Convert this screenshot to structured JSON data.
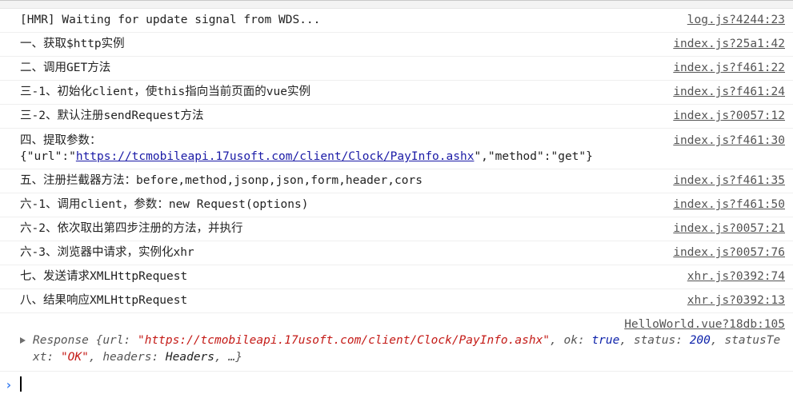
{
  "logs": [
    {
      "message": "[HMR] Waiting for update signal from WDS...",
      "source": "log.js?4244:23"
    },
    {
      "message": "一、获取$http实例",
      "source": "index.js?25a1:42"
    },
    {
      "message": "二、调用GET方法",
      "source": "index.js?f461:22"
    },
    {
      "message": "三-1、初始化client，使this指向当前页面的vue实例",
      "source": "index.js?f461:24"
    },
    {
      "message": "三-2、默认注册sendRequest方法",
      "source": "index.js?0057:12"
    },
    {
      "message": "四、提取参数：",
      "source": "index.js?f461:30",
      "json_prefix": "{\"url\":\"",
      "json_link": "https://tcmobileapi.17usoft.com/client/Clock/PayInfo.ashx",
      "json_suffix": "\",\"method\":\"get\"}"
    },
    {
      "message": "五、注册拦截器方法：before,method,jsonp,json,form,header,cors",
      "source": "index.js?f461:35"
    },
    {
      "message": "六-1、调用client，参数：new Request(options)",
      "source": "index.js?f461:50"
    },
    {
      "message": "六-2、依次取出第四步注册的方法，并执行",
      "source": "index.js?0057:21"
    },
    {
      "message": "六-3、浏览器中请求，实例化xhr",
      "source": "index.js?0057:76"
    },
    {
      "message": "七、发送请求XMLHttpRequest",
      "source": "xhr.js?0392:74"
    },
    {
      "message": "八、结果响应XMLHttpRequest",
      "source": "xhr.js?0392:13"
    }
  ],
  "response_log": {
    "source": "HelloWorld.vue?18db:105",
    "type_name": "Response",
    "open_brace": " {",
    "url_key": "url",
    "url_value": "\"https://tcmobileapi.17usoft.com/client/Clock/PayInfo.ashx\"",
    "ok_key": "ok",
    "ok_value": "true",
    "status_key": "status",
    "status_value": "200",
    "status_text_key": "statusText",
    "status_text_value": "\"OK\"",
    "headers_key": "headers",
    "headers_value": "Headers",
    "ellipsis": "…}"
  },
  "colors": {
    "string": "#c41a16",
    "keyword": "#0d22aa",
    "link": "#1a1aa6",
    "prompt": "#367cf1"
  },
  "icons": {
    "expand": "triangle-right-icon",
    "prompt": "chevron-right-icon"
  }
}
